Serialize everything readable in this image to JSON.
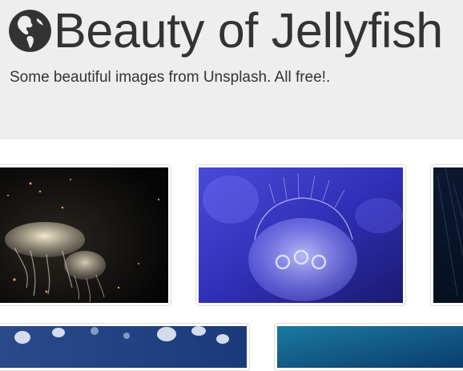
{
  "header": {
    "logo_icon": "globe-americas-icon",
    "title": "Beauty of Jellyfish",
    "subtitle": "Some beautiful images from Unsplash. All free!."
  },
  "gallery": {
    "images": [
      {
        "subject": "jellyfish-dark-background"
      },
      {
        "subject": "jellyfish-blue-glow"
      },
      {
        "subject": "dark-blue-water-streaks"
      },
      {
        "subject": "jellyfish-school-blue"
      },
      {
        "subject": "teal-water-gradient"
      }
    ]
  },
  "colors": {
    "header_bg": "#eeeeee",
    "text": "#333333",
    "thumb_border": "#dddddd"
  }
}
